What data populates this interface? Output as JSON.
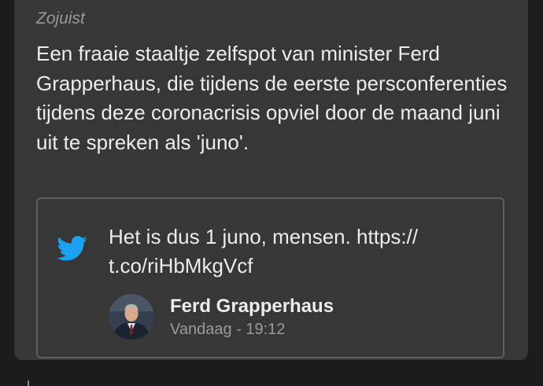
{
  "post": {
    "timestamp": "Zojuist",
    "text": "Een fraaie staaltje zelfspot van minister Ferd Grapperhaus, die tijdens de eerste persconferenties tijdens deze coronacrisis opviel door de maand juni uit te spreken als 'juno'."
  },
  "tweet": {
    "icon": "twitter-bird-icon",
    "text": "Het is dus 1 juno, mensen. https:// t.co/riHbMkgVcf",
    "author_name": "Ferd Grapperhaus",
    "date": "Vandaag - 19:12"
  },
  "colors": {
    "background": "#1c1c1e",
    "card": "#373737",
    "twitter_blue": "#1da1f2",
    "text": "#ececec",
    "muted": "#9a9a9a"
  }
}
